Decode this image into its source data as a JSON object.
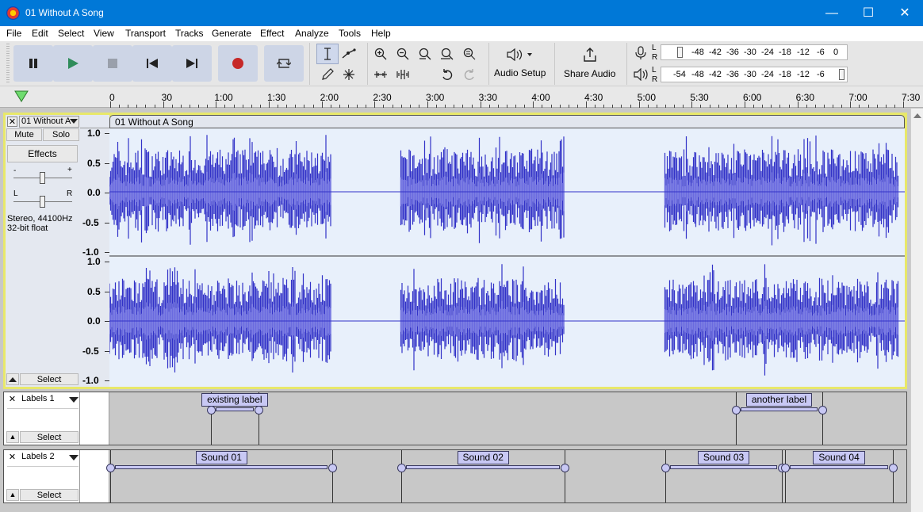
{
  "window": {
    "title": "01 Without A Song",
    "minimize": "—",
    "maximize": "☐",
    "close": "✕"
  },
  "menu": [
    "File",
    "Edit",
    "Select",
    "View",
    "Transport",
    "Tracks",
    "Generate",
    "Effect",
    "Analyze",
    "Tools",
    "Help"
  ],
  "toolbar": {
    "audio_setup": "Audio Setup",
    "share_audio": "Share Audio",
    "record_meter_ticks": [
      "L",
      "R",
      "-48",
      "-42",
      "-36",
      "-30",
      "-24",
      "-18",
      "-12",
      "-6",
      "0"
    ],
    "play_meter_ticks": [
      "L",
      "R",
      "-54",
      "-48",
      "-42",
      "-36",
      "-30",
      "-24",
      "-18",
      "-12",
      "-6"
    ]
  },
  "timeline": {
    "ticks": [
      "0",
      "30",
      "1:00",
      "1:30",
      "2:00",
      "2:30",
      "3:00",
      "3:30",
      "4:00",
      "4:30",
      "5:00",
      "5:30",
      "6:00",
      "6:30",
      "7:00",
      "7:30"
    ]
  },
  "audio_track": {
    "name": "01 Without A",
    "clip_name": "01 Without A Song",
    "mute": "Mute",
    "solo": "Solo",
    "effects": "Effects",
    "gain_minus": "-",
    "gain_plus": "+",
    "pan_left": "L",
    "pan_right": "R",
    "format_line1": "Stereo, 44100Hz",
    "format_line2": "32-bit float",
    "select": "Select",
    "scale": [
      "1.0",
      "0.5",
      "0.0",
      "-0.5",
      "-1.0"
    ]
  },
  "label_tracks": [
    {
      "name": "Labels 1",
      "select": "Select",
      "labels": [
        {
          "text": "existing label",
          "start": "0:57",
          "end": "1:24"
        },
        {
          "text": "another label",
          "start": "5:55",
          "end": "6:44"
        }
      ]
    },
    {
      "name": "Labels 2",
      "select": "Select",
      "labels": [
        {
          "text": "Sound 01",
          "start": "0:00",
          "end": "2:06"
        },
        {
          "text": "Sound 02",
          "start": "2:45",
          "end": "4:18"
        },
        {
          "text": "Sound 03",
          "start": "5:15",
          "end": "6:21"
        },
        {
          "text": "Sound 04",
          "start": "6:23",
          "end": "7:24"
        }
      ]
    }
  ],
  "colors": {
    "titlebar": "#0078d7",
    "waveform": "#3232c8",
    "waveform_bg": "#e8f0fb",
    "selected_track_border": "#e8e86a",
    "record_red": "#c62828",
    "label_fill": "#c8c8f4"
  }
}
